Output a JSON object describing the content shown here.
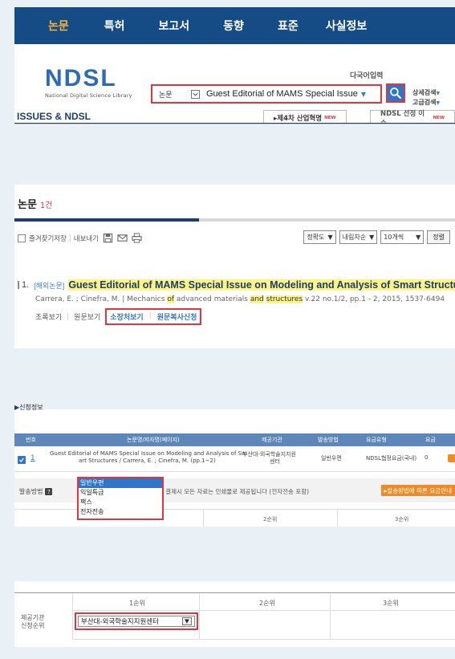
{
  "nav": {
    "items": [
      "논문",
      "특허",
      "보고서",
      "동향",
      "표준",
      "사실정보"
    ]
  },
  "logo": {
    "mark": "NDSL",
    "subtitle": "National Digital Science Library"
  },
  "search": {
    "multilang": "다국어입력",
    "category": "논문",
    "query": "Guest Editorial of MAMS Special Issue",
    "advanced": "상세검색",
    "advanced2": "고급검색"
  },
  "issues": {
    "title": "ISSUES & NDSL",
    "tab1": "▸제4차 산업혁명",
    "tab2": "NDSL 선정 이슈",
    "new_badge": "NEW"
  },
  "results": {
    "heading": "논문",
    "count": "1건",
    "tools": {
      "favorite": "즐겨찾기저장",
      "export": "내보내기"
    },
    "sort1": "정확도",
    "sort2": "내림차순",
    "per_page": "10개씩",
    "sort_button": "정렬",
    "item": {
      "number": "1.",
      "type": "[해외논문]",
      "title_a": "Guest Editorial of MAMS Special Issue on ",
      "title_b": "Modeling and Analysis of Smart Structures",
      "authors": "Carrera, E. ; Cinefra, M. | Mechanics ",
      "of": "of",
      "mid": " advanced materials ",
      "and": "and",
      "structures": "structures",
      "rest": " v.22 no.1/2, pp.1 - 2, 2015, 1537-6494",
      "link1": "초록보기",
      "link2": "원문보기",
      "link3": "소장처보기",
      "link4": "원문복사신청"
    }
  },
  "request": {
    "title": "신청정보",
    "headers": [
      "번호",
      "논문명/저자명(페이지)",
      "제공기관",
      "발송방법",
      "요금유형",
      "요금"
    ],
    "row": {
      "num": "1",
      "title1": "Guest Editorial of MAMS Special Issue on Modeling and Analysis of Sm",
      "title2": "art Structures / Carrera, E. ; Cinefra, M. (pp.1~2)",
      "provider1": "부산대-외국학술지지원",
      "provider2": "센터",
      "method": "일반우편",
      "fee_type": "NDSL협정요금(국내)",
      "fee": "0"
    },
    "delivery_label": "발송방법",
    "delivery_note": "후불 결제시 모든 자료는 인쇄물로 제공됩니다 (전자전송 포함)",
    "fee_button": "▸발송방법에 따른 요금안내",
    "options": [
      "일반우편",
      "익일특급",
      "팩스",
      "전자전송"
    ],
    "rank2": "2순위",
    "rank3": "3순위"
  },
  "priority": {
    "label1": "제공기관",
    "label2": "신청순위",
    "rank1": "1순위",
    "rank2": "2순위",
    "rank3": "3순위",
    "selected": "부산대-외국학술지지원센터"
  }
}
